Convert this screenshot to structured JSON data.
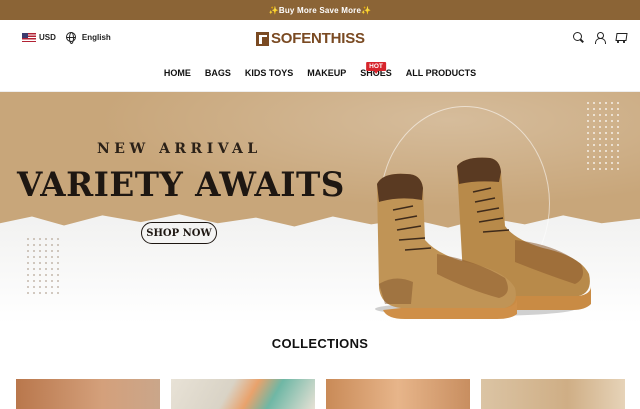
{
  "announcement": "✨Buy More Save More✨",
  "header": {
    "currency": "USD",
    "language": "English",
    "logo_text": "SOFENTHISS",
    "icons": [
      "search-icon",
      "account-icon",
      "cart-icon"
    ]
  },
  "nav": {
    "items": [
      {
        "label": "HOME"
      },
      {
        "label": "BAGS"
      },
      {
        "label": "KIDS TOYS"
      },
      {
        "label": "MAKEUP"
      },
      {
        "label": "SHOES",
        "badge": "HOT"
      },
      {
        "label": "ALL PRODUCTS"
      }
    ]
  },
  "banner": {
    "eyebrow": "NEW ARRIVAL",
    "headline": "VARIETY AWAITS",
    "cta": "SHOP NOW"
  },
  "collections": {
    "title": "COLLECTIONS"
  },
  "colors": {
    "announcement_bg": "#8b6436",
    "brand": "#7a4a22",
    "banner_bg": "#c8a67a",
    "hot_badge": "#d7252c"
  }
}
